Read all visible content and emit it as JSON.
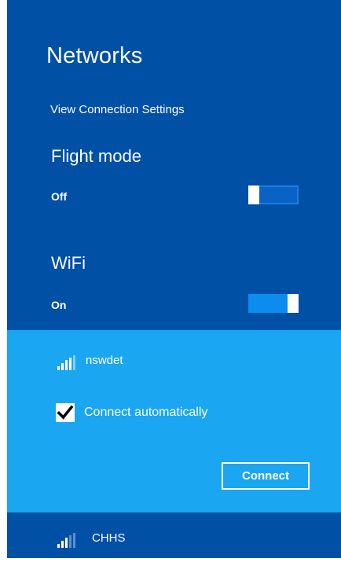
{
  "header": {
    "title": "Networks",
    "view_settings_label": "View Connection Settings"
  },
  "flight_mode": {
    "title": "Flight mode",
    "state_label": "Off",
    "enabled": false
  },
  "wifi": {
    "title": "WiFi",
    "state_label": "On",
    "enabled": true
  },
  "networks": [
    {
      "name": "nswdet",
      "icon": "wifi-signal-icon",
      "selected": true,
      "connect_automatically": {
        "label": "Connect automatically",
        "checked": true
      },
      "connect_button_label": "Connect"
    },
    {
      "name": "CHHS",
      "icon": "wifi-signal-icon",
      "selected": false
    }
  ],
  "colors": {
    "panel_bg": "#0050a6",
    "selected_bg": "#1aa6f0",
    "toggle_on": "#0d8cf0",
    "text": "#ffffff"
  }
}
